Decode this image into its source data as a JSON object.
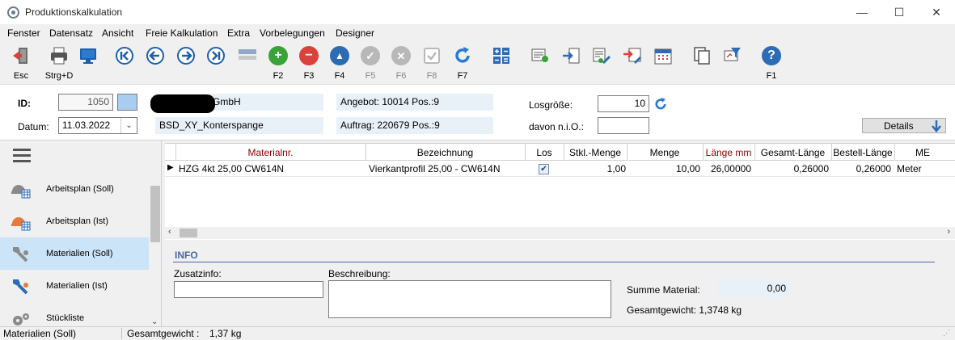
{
  "window": {
    "title": "Produktionskalkulation",
    "minimize": "—",
    "maximize": "☐",
    "close": "✕"
  },
  "menu": [
    "Fenster",
    "Datensatz",
    "Ansicht",
    "Freie Kalkulation",
    "Extra",
    "Vorbelegungen",
    "Designer"
  ],
  "toolbar": {
    "esc": "Esc",
    "print": "Strg+D",
    "f2": "F2",
    "f3": "F3",
    "f4": "F4",
    "f5": "F5",
    "f6": "F6",
    "f8": "F8",
    "f7": "F7",
    "f1": "F1"
  },
  "header": {
    "id_label": "ID:",
    "id_value": "1050",
    "date_label": "Datum:",
    "date_value": "11.03.2022",
    "company_suffix": "GmbH",
    "part_name": "BSD_XY_Konterspange",
    "offer": "Angebot: 10014 Pos.:9",
    "order": "Auftrag: 220679 Pos.:9",
    "lot_label": "Losgröße:",
    "lot_value": "10",
    "nio_label": "davon n.i.O.:",
    "nio_value": "",
    "details": "Details"
  },
  "sidebar": {
    "items": [
      {
        "label": "Arbeitsplan (Soll)"
      },
      {
        "label": "Arbeitsplan (Ist)"
      },
      {
        "label": "Materialien (Soll)"
      },
      {
        "label": "Materialien (Ist)"
      },
      {
        "label": "Stückliste"
      }
    ]
  },
  "grid": {
    "columns": [
      "Materialnr.",
      "Bezeichnung",
      "Los",
      "Stkl.-Menge",
      "Menge",
      "Länge mm",
      "Gesamt-Länge",
      "Bestell-Länge",
      "ME"
    ],
    "rows": [
      {
        "materialnr": "HZG 4kt 25,00 CW614N",
        "bezeichnung": "Vierkantprofil 25,00 - CW614N",
        "los": true,
        "stkl_menge": "1,00",
        "menge": "10,00",
        "laenge": "26,00000",
        "gesamt": "0,26000",
        "bestell": "0,26000",
        "me": "Meter"
      }
    ]
  },
  "info": {
    "title": "INFO",
    "zusatz_label": "Zusatzinfo:",
    "beschreibung_label": "Beschreibung:",
    "summe_label": "Summe Material:",
    "summe_value": "0,00",
    "gewicht_text": "Gesamtgewicht: 1,3748 kg"
  },
  "status": {
    "view": "Materialien (Soll)",
    "weight_label": "Gesamtgewicht :",
    "weight_value": "1,37 kg"
  },
  "colors": {
    "accent_blue": "#2b6cb5",
    "green": "#39a339",
    "red": "#d9413a",
    "selection": "#cce4f7"
  }
}
